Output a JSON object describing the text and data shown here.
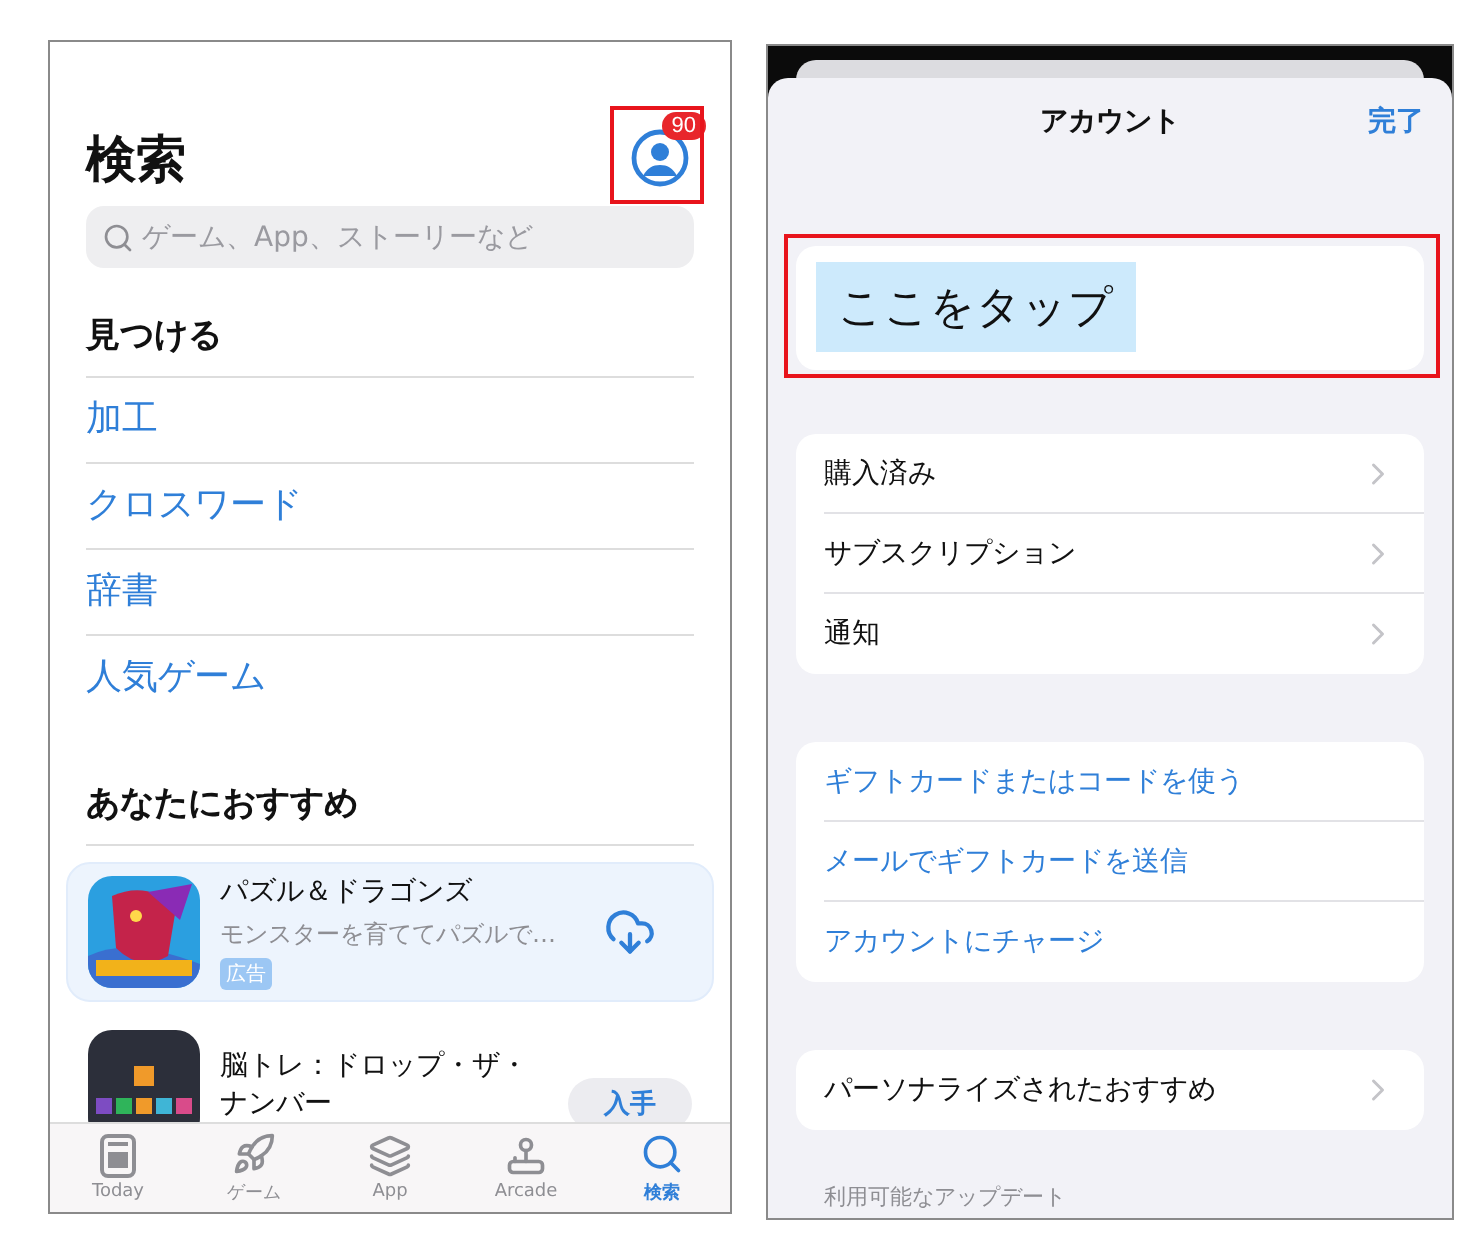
{
  "search_screen": {
    "title": "検索",
    "account": {
      "badge": "90",
      "annotated": true
    },
    "search": {
      "placeholder": "ゲーム、App、ストーリーなど"
    },
    "discover": {
      "heading": "見つける",
      "links": [
        "加工",
        "クロスワード",
        "辞書",
        "人気ゲーム"
      ]
    },
    "recommended": {
      "heading": "あなたにおすすめ",
      "apps": [
        {
          "name": "パズル＆ドラゴンズ",
          "subtitle": "モンスターを育ててパズルで…",
          "badge": "広告",
          "kind": "download",
          "highlighted": true
        },
        {
          "name": "脳トレ：ドロップ・ザ・ナンバー",
          "kind": "get",
          "action_label": "入手",
          "highlighted": false
        }
      ]
    },
    "tab_bar": [
      {
        "label": "Today",
        "kind": "today",
        "selected": false
      },
      {
        "label": "ゲーム",
        "kind": "games",
        "selected": false
      },
      {
        "label": "App",
        "kind": "apps",
        "selected": false
      },
      {
        "label": "Arcade",
        "kind": "arcade",
        "selected": false
      },
      {
        "label": "検索",
        "kind": "search",
        "selected": true
      }
    ]
  },
  "account_sheet": {
    "title": "アカウント",
    "done": "完了",
    "account_row": {
      "callout": "ここをタップ",
      "annotated": true
    },
    "groups": [
      {
        "kind": "nav",
        "rows": [
          "購入済み",
          "サブスクリプション",
          "通知"
        ]
      },
      {
        "kind": "link",
        "rows": [
          "ギフトカードまたはコードを使う",
          "メールでギフトカードを送信",
          "アカウントにチャージ"
        ]
      },
      {
        "kind": "nav",
        "rows": [
          "パーソナライズされたおすすめ"
        ]
      }
    ],
    "footer_label": "利用可能なアップデート"
  }
}
